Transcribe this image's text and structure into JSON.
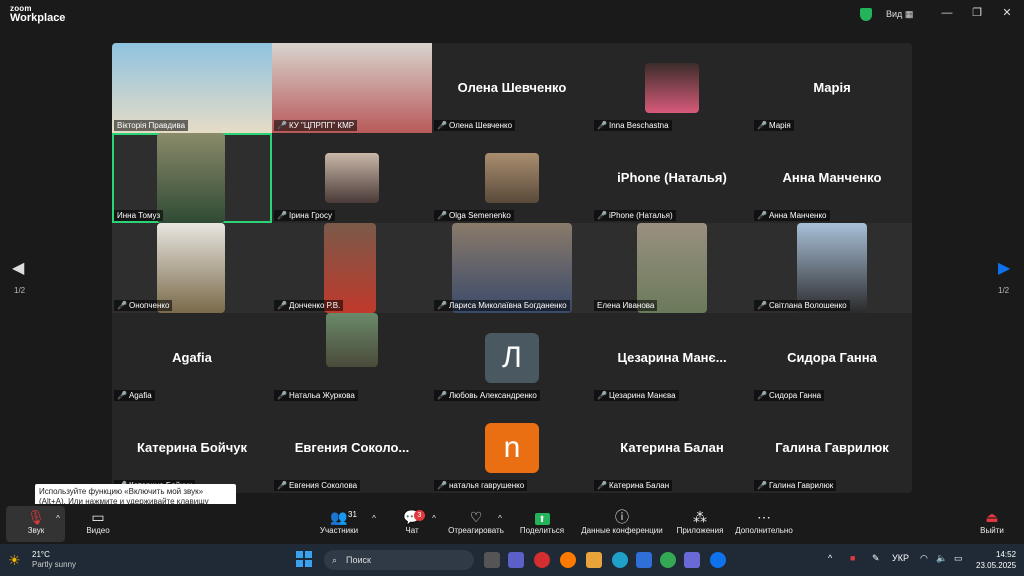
{
  "app": {
    "logo_small": "zoom",
    "logo_big": "Workplace",
    "view_label": "Вид"
  },
  "window_controls": {
    "minimize": "—",
    "maximize": "❐",
    "close": "✕"
  },
  "pagination": {
    "left": "1/2",
    "right": "1/2"
  },
  "tiles": [
    {
      "name": "Вікторія Правдива",
      "bigname": "",
      "video": true,
      "active": false
    },
    {
      "name": "КУ \"ЦПРПП\" КМР",
      "bigname": "",
      "video": true,
      "active": false
    },
    {
      "name": "Олена Шевченко",
      "bigname": "Олена Шевченко",
      "video": false,
      "active": false
    },
    {
      "name": "Inna Beschastna",
      "bigname": "",
      "video": false,
      "active": false
    },
    {
      "name": "Марія",
      "bigname": "Марія",
      "video": false,
      "active": false
    },
    {
      "name": "Инна Томуз",
      "bigname": "",
      "video": true,
      "active": true
    },
    {
      "name": "Ірина  Гросу",
      "bigname": "",
      "video": false,
      "active": false
    },
    {
      "name": "Olga Semenenko",
      "bigname": "",
      "video": false,
      "active": false
    },
    {
      "name": "iPhone (Наталья)",
      "bigname": "iPhone (Наталья)",
      "video": false,
      "active": false
    },
    {
      "name": "Анна Манченко",
      "bigname": "Анна Манченко",
      "video": false,
      "active": false
    },
    {
      "name": "Онопченко",
      "bigname": "",
      "video": true,
      "active": false
    },
    {
      "name": "Донченко Р.В.",
      "bigname": "",
      "video": true,
      "active": false
    },
    {
      "name": "Лариса Миколаївна Богданенко",
      "bigname": "",
      "video": true,
      "active": false
    },
    {
      "name": "Елена Иванова",
      "bigname": "",
      "video": true,
      "active": false
    },
    {
      "name": "Світлана Волошенко",
      "bigname": "",
      "video": true,
      "active": false
    },
    {
      "name": "Agafia",
      "bigname": "Agafia",
      "video": false,
      "active": false
    },
    {
      "name": "Натальа Журкова",
      "bigname": "",
      "video": false,
      "active": false
    },
    {
      "name": "Любовь Александренко",
      "bigname": "",
      "video": false,
      "active": false,
      "avatar": "Л",
      "avatar_color": "#4a5862"
    },
    {
      "name": "Цезарина Манєва",
      "bigname": "Цезарина  Манє...",
      "video": false,
      "active": false
    },
    {
      "name": "Сидора Ганна",
      "bigname": "Сидора Ганна",
      "video": false,
      "active": false
    },
    {
      "name": "Катерина Бойчук",
      "bigname": "Катерина Бойчук",
      "video": false,
      "active": false
    },
    {
      "name": "Евгения Соколова",
      "bigname": "Евгения  Соколо...",
      "video": false,
      "active": false
    },
    {
      "name": "наталья гаврушенко",
      "bigname": "",
      "video": false,
      "active": false,
      "avatar": "n",
      "avatar_color": "#ea6e12"
    },
    {
      "name": "Катерина Балан",
      "bigname": "Катерина Балан",
      "video": false,
      "active": false
    },
    {
      "name": "Галина Гаврилюк",
      "bigname": "Галина Гаврилюк",
      "video": false,
      "active": false
    }
  ],
  "tooltip": {
    "text": "Используйте функцию «Включить мой звук» (Alt+A). Или нажмите и удерживайте клавишу Space, чтобы временно включить звук."
  },
  "toolbar": {
    "audio": "Звук",
    "video": "Видео",
    "participants": "Участники",
    "participants_count": "31",
    "chat": "Чат",
    "chat_badge": "3",
    "react": "Отреагировать",
    "share": "Поделиться",
    "info": "Данные конференции",
    "apps": "Приложения",
    "more": "Дополнительно",
    "leave": "Выйти"
  },
  "taskbar": {
    "temp": "21°C",
    "weather": "Partly sunny",
    "search_placeholder": "Поиск",
    "lang": "УКР",
    "time": "14:52",
    "date": "23.05.2025"
  },
  "colors": {
    "active_outline": "#2bd577",
    "mute": "#e0393e",
    "accent": "#0e72ed"
  }
}
